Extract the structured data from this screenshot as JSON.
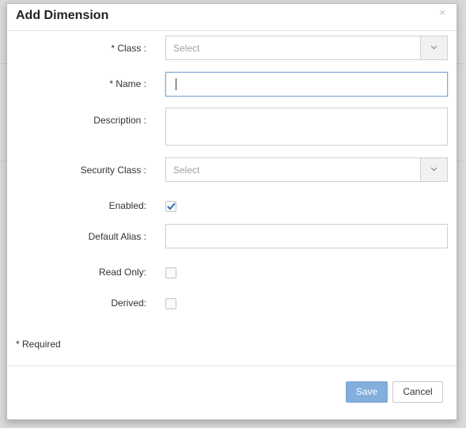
{
  "dialog": {
    "title": "Add Dimension",
    "close_glyph": "×",
    "fields": {
      "class": {
        "label": "* Class :",
        "placeholder": "Select"
      },
      "name": {
        "label": "* Name :",
        "value": ""
      },
      "description": {
        "label": "Description :",
        "value": ""
      },
      "security_class": {
        "label": "Security Class :",
        "placeholder": "Select"
      },
      "enabled": {
        "label": "Enabled:",
        "checked": true
      },
      "default_alias": {
        "label": "Default Alias :",
        "value": ""
      },
      "read_only": {
        "label": "Read Only:",
        "checked": false
      },
      "derived": {
        "label": "Derived:",
        "checked": false
      }
    },
    "required_note": "* Required",
    "buttons": {
      "save": "Save",
      "cancel": "Cancel"
    }
  },
  "icons": {
    "select_arrow": "chevron-down-icon",
    "check": "checkmark-icon",
    "close": "close-icon"
  },
  "colors": {
    "save_button": "#84aedb",
    "focus_border": "#7fa8d6",
    "check_color": "#2f6fb3"
  }
}
